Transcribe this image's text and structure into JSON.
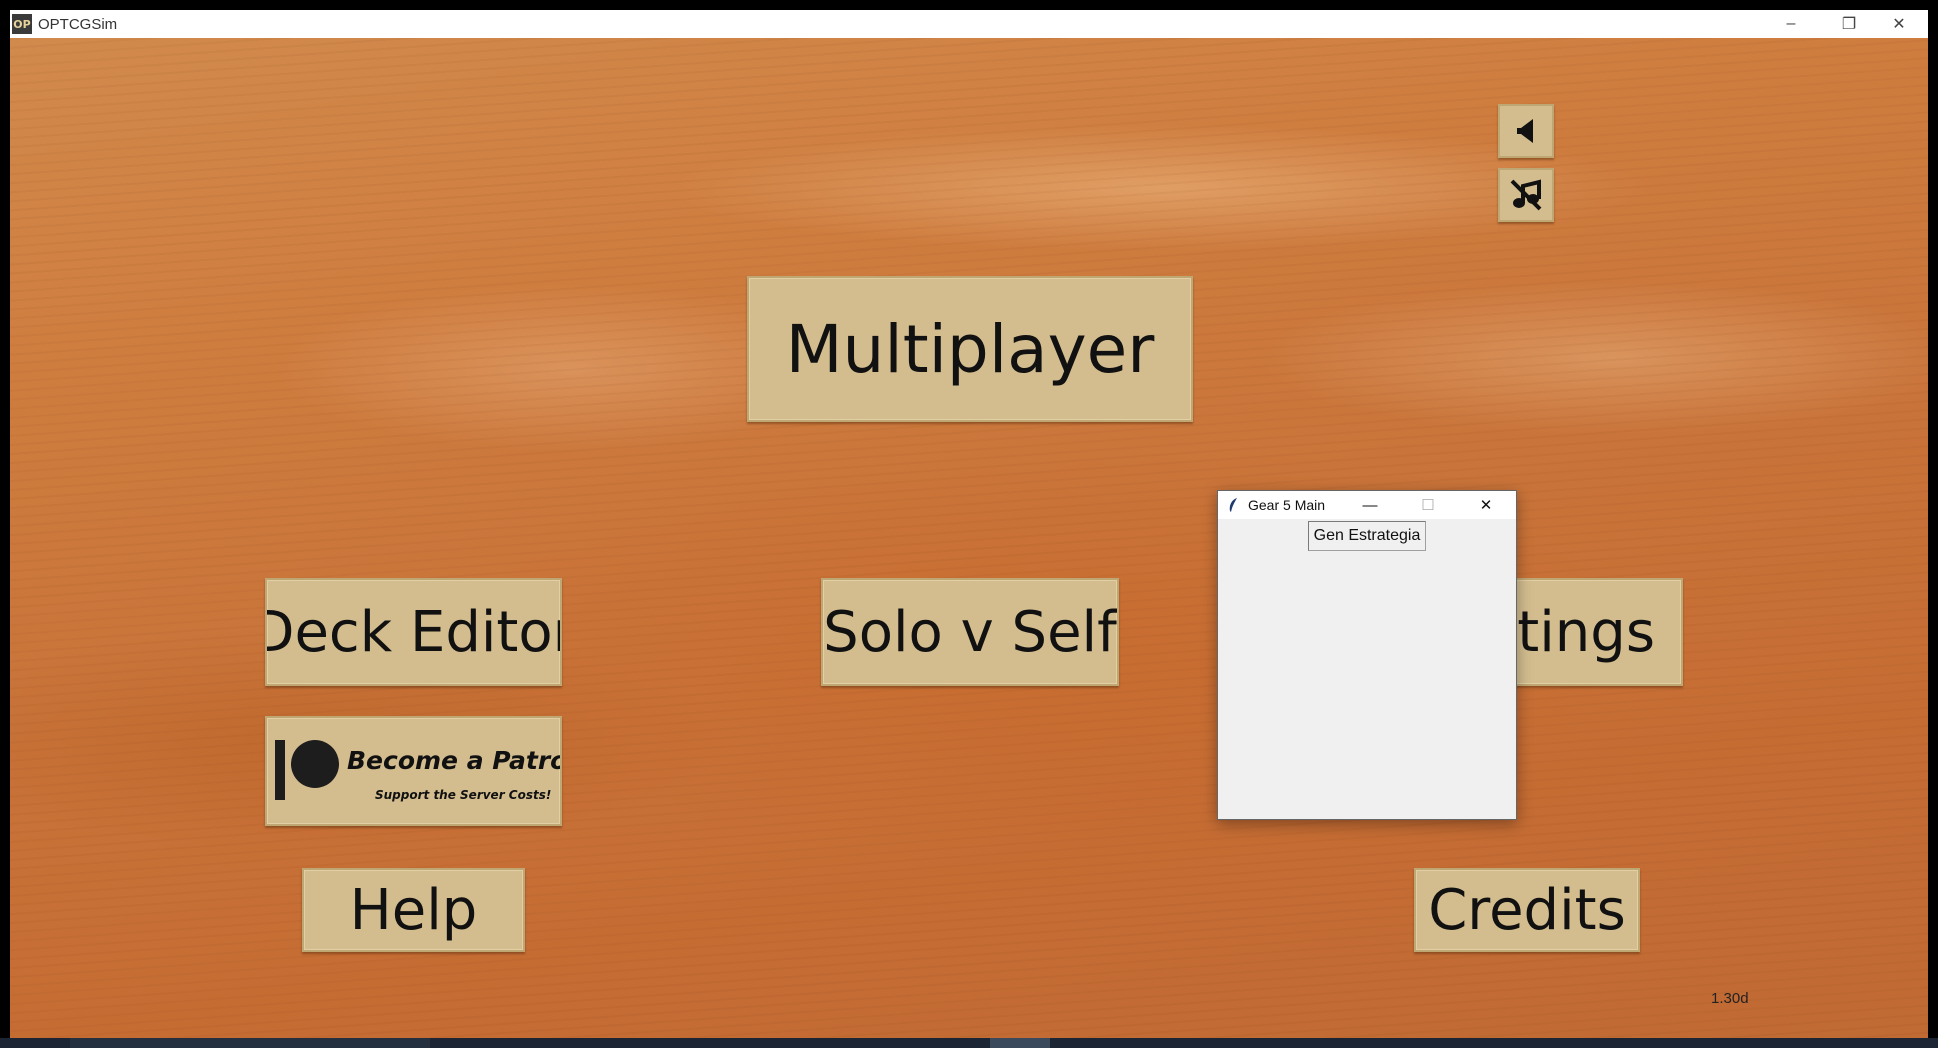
{
  "window": {
    "title": "OPTCGSim",
    "app_icon_text": "OP",
    "controls": {
      "minimize": "–",
      "restore": "❐",
      "close": "✕"
    }
  },
  "audio": {
    "sound_icon": "speaker-icon",
    "music_icon": "music-muted-icon"
  },
  "menu": {
    "multiplayer": "Multiplayer",
    "deck_editor": "Deck Editor",
    "solo_v_self": "Solo v Self",
    "settings_visible": "tings",
    "patron_title": "Become a Patron",
    "patron_subtitle": "Support the Server Costs!",
    "help": "Help",
    "credits": "Credits"
  },
  "version": "1.30d",
  "dialog": {
    "title": "Gear 5 Main",
    "controls": {
      "minimize": "—",
      "maximize": "☐",
      "close": "✕"
    },
    "button": "Gen Estrategia"
  },
  "colors": {
    "button_fill": "#d3bd8f",
    "button_border": "#bfa774",
    "wood": "#c9743a",
    "dialog_bg": "#f0f0f0"
  }
}
